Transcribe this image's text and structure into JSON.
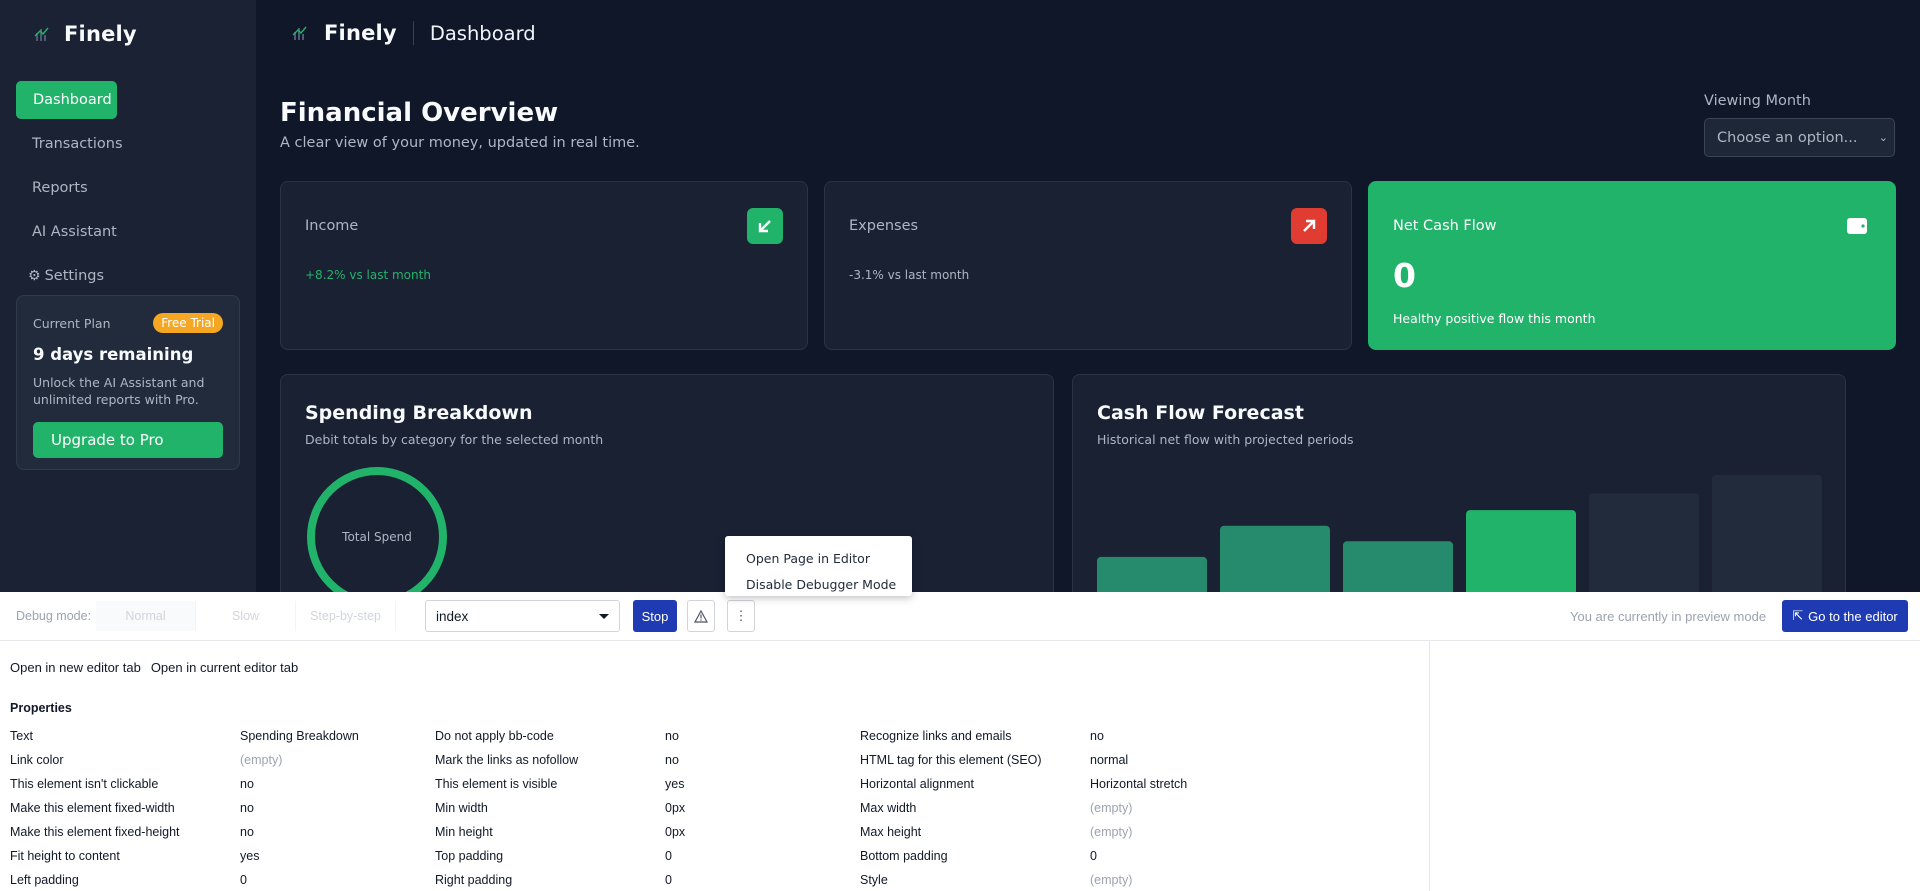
{
  "app": {
    "brand": "Finely",
    "page_name": "Dashboard"
  },
  "sidebar": {
    "items": [
      {
        "label": "Dashboard",
        "active": true
      },
      {
        "label": "Transactions"
      },
      {
        "label": "Reports"
      },
      {
        "label": "AI Assistant"
      },
      {
        "label": "Settings",
        "icon": "gear-icon"
      }
    ],
    "plan": {
      "label": "Current Plan",
      "badge": "Free Trial",
      "days": "9 days remaining",
      "description": "Unlock the AI Assistant and unlimited reports with Pro.",
      "upgrade": "Upgrade to Pro"
    }
  },
  "main": {
    "title": "Financial Overview",
    "subtitle": "A clear view of your money, updated in real time.",
    "month_label": "Viewing Month",
    "month_placeholder": "Choose an option...",
    "cards": {
      "income": {
        "name": "Income",
        "delta": "+8.2% vs last month",
        "icon": "arrow-down-left-icon",
        "color": "#22b36a"
      },
      "expenses": {
        "name": "Expenses",
        "delta": "-3.1% vs last month",
        "icon": "arrow-up-right-icon",
        "color": "#e03c31"
      },
      "net": {
        "name": "Net Cash Flow",
        "value": "0",
        "sub": "Healthy positive flow this month",
        "icon": "wallet-icon",
        "color": "#22b36a"
      }
    },
    "spending": {
      "title": "Spending Breakdown",
      "subtitle": "Debit totals by category for the selected month",
      "center_label": "Total Spend"
    },
    "forecast": {
      "title": "Cash Flow Forecast",
      "subtitle": "Historical net flow with projected periods"
    }
  },
  "chart_data": {
    "type": "bar",
    "title": "Cash Flow Forecast",
    "bars": [
      {
        "value": 0.37,
        "kind": "historical",
        "color": "#268a6c"
      },
      {
        "value": 0.61,
        "kind": "historical",
        "color": "#268a6c"
      },
      {
        "value": 0.49,
        "kind": "historical",
        "color": "#268a6c"
      },
      {
        "value": 0.73,
        "kind": "current",
        "color": "#22b36a"
      },
      {
        "value": 0.86,
        "kind": "projected",
        "color": "#222b3c"
      },
      {
        "value": 1.0,
        "kind": "projected",
        "color": "#222b3c"
      }
    ]
  },
  "context_menu": {
    "items": [
      "Open Page in Editor",
      "Disable Debugger Mode"
    ]
  },
  "debug": {
    "label": "Debug mode:",
    "modes": [
      "Normal",
      "Slow",
      "Step-by-step"
    ],
    "page": "index",
    "stop": "Stop",
    "preview_note": "You are currently in preview mode",
    "editor_button": "Go to the editor",
    "links": [
      "Open in new editor tab",
      "Open in current editor tab"
    ],
    "properties_title": "Properties",
    "properties": [
      [
        "Text",
        "Spending Breakdown",
        "Do not apply bb-code",
        "no",
        "Recognize links and emails",
        "no"
      ],
      [
        "Link color",
        "(empty)",
        "Mark the links as nofollow",
        "no",
        "HTML tag for this element (SEO)",
        "normal"
      ],
      [
        "This element isn't clickable",
        "no",
        "This element is visible",
        "yes",
        "Horizontal alignment",
        "Horizontal stretch"
      ],
      [
        "Make this element fixed-width",
        "no",
        "Min width",
        "0px",
        "Max width",
        "(empty)"
      ],
      [
        "Make this element fixed-height",
        "no",
        "Min height",
        "0px",
        "Max height",
        "(empty)"
      ],
      [
        "Fit height to content",
        "yes",
        "Top padding",
        "0",
        "Bottom padding",
        "0"
      ],
      [
        "Left padding",
        "0",
        "Right padding",
        "0",
        "Style",
        "(empty)"
      ]
    ]
  }
}
